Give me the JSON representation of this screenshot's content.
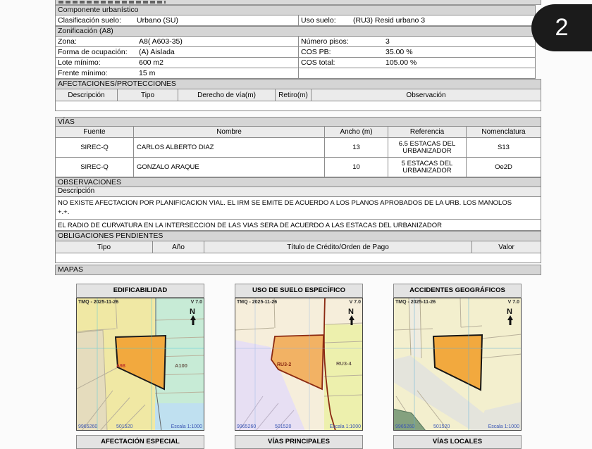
{
  "badge": "2",
  "componente": {
    "title": "Componente urbanístico",
    "row": {
      "left_label": "Clasificación suelo:",
      "left_value": "Urbano (SU)",
      "right_label": "Uso suelo:",
      "right_value": "(RU3) Resid urbano 3"
    }
  },
  "zonificacion": {
    "title": "Zonificación (A8)",
    "rows": [
      {
        "left_label": "Zona:",
        "left_value": "A8( A603-35)",
        "right_label": "Número pisos:",
        "right_value": "3"
      },
      {
        "left_label": "Forma de ocupación:",
        "left_value": "(A) Aislada",
        "right_label": "COS PB:",
        "right_value": "35.00 %"
      },
      {
        "left_label": "Lote mínimo:",
        "left_value": "600 m2",
        "right_label": "COS total:",
        "right_value": "105.00 %"
      },
      {
        "left_label": "Frente mínimo:",
        "left_value": "15 m",
        "right_label": "",
        "right_value": ""
      }
    ]
  },
  "afectaciones": {
    "title": "AFECTACIONES/PROTECCIONES",
    "columns": [
      "Descripción",
      "Tipo",
      "Derecho de vía(m)",
      "Retiro(m)",
      "Observación"
    ]
  },
  "vias": {
    "title": "VÍAS",
    "columns": [
      "Fuente",
      "Nombre",
      "Ancho (m)",
      "Referencia",
      "Nomenclatura"
    ],
    "rows": [
      {
        "fuente": "SIREC-Q",
        "nombre": "CARLOS ALBERTO DIAZ",
        "ancho": "13",
        "referencia": "6.5 ESTACAS DEL URBANIZADOR",
        "nomenclatura": "S13"
      },
      {
        "fuente": "SIREC-Q",
        "nombre": "GONZALO ARAQUE",
        "ancho": "10",
        "referencia": "5 ESTACAS DEL URBANIZADOR",
        "nomenclatura": "Oe2D"
      }
    ]
  },
  "observaciones": {
    "title": "OBSERVACIONES",
    "subheader": "Descripción",
    "items": [
      {
        "line1": "NO EXISTE AFECTACION POR PLANIFICACION VIAL. EL IRM SE EMITE DE ACUERDO A LOS PLANOS APROBADOS DE LA URB. LOS MANOLOS",
        "line2": "+.+."
      },
      {
        "line1": "EL RADIO DE CURVATURA EN LA INTERSECCION DE LAS VIAS SERA DE ACUERDO A LAS ESTACAS DEL URBANIZADOR",
        "line2": ""
      }
    ]
  },
  "obligaciones": {
    "title": "OBLIGACIONES PENDIENTES",
    "columns": [
      "Tipo",
      "Año",
      "Título de Crédito/Orden de Pago",
      "Valor"
    ]
  },
  "mapas": {
    "title": "MAPAS",
    "stamp": "TMQ - 2025-11-26",
    "version": "V 7.0",
    "north_label": "N",
    "coord_left": "9965260",
    "coord_mid": "501520",
    "scale": "Escala 1:1000",
    "panels": [
      {
        "title": "EDIFICABILIDAD",
        "label_a": "A98",
        "label_b": "A100"
      },
      {
        "title": "USO DE SUELO ESPECÍFICO",
        "label_a": "RU3-2",
        "label_b": "RU3-4"
      },
      {
        "title": "ACCIDENTES GEOGRÁFICOS",
        "label_a": "",
        "label_b": ""
      }
    ],
    "next_panels": [
      "AFECTACIÓN ESPECIAL",
      "VÍAS PRINCIPALES",
      "VÍAS LOCALES"
    ]
  },
  "colors": {
    "section_bar_bg": "#d5d5d5",
    "table_header_bg": "#ebebeb",
    "border_gray": "#8c8c8c",
    "badge_bg": "#1b1b1b",
    "parcel_orange": "#f2a93e",
    "parcel_orange_light": "#f2b264",
    "map_teal": "#c7ebd6",
    "map_lavender": "#e7dff3",
    "map_yellow": "#f0e8a4",
    "map_green_patch": "#84a17f",
    "coord_text_blue": "#3a56b4"
  }
}
